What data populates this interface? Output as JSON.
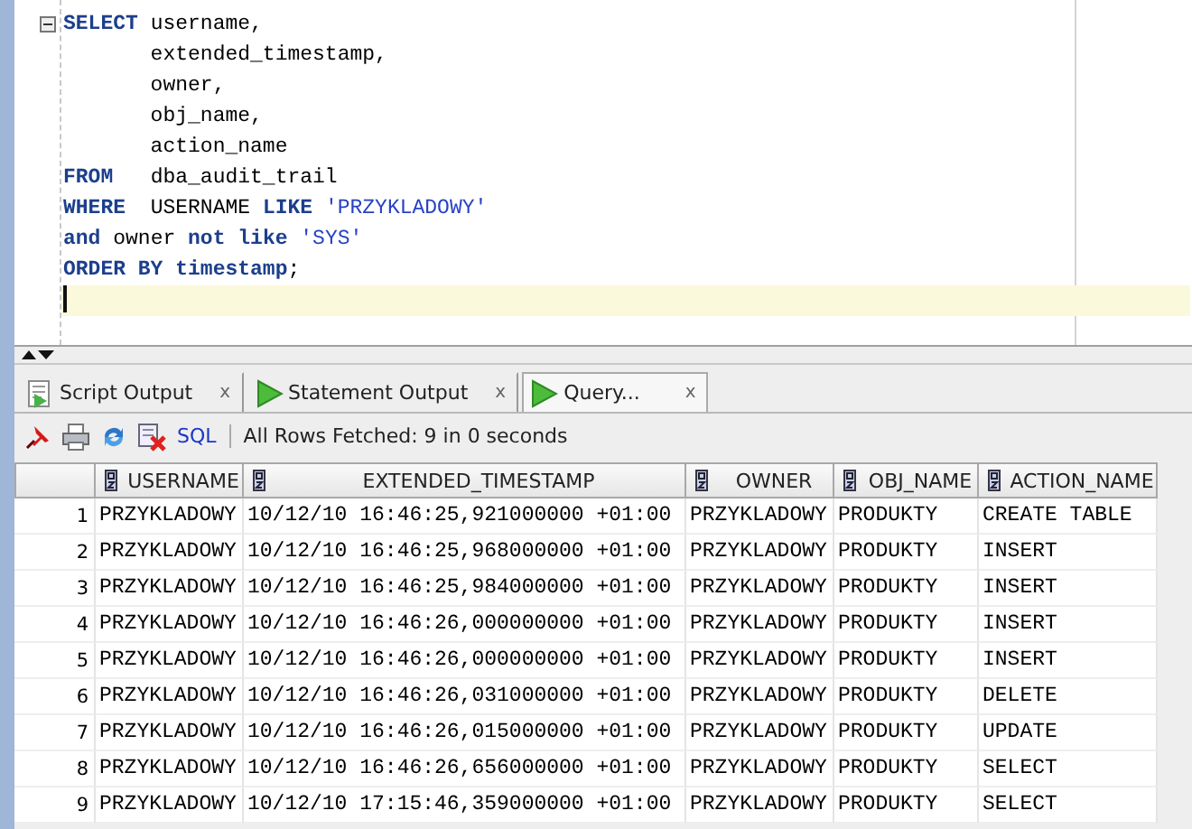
{
  "editor": {
    "lines": [
      {
        "fold_marker": true,
        "current": false,
        "tokens": [
          {
            "kind": "keyword",
            "text": "SELECT"
          },
          {
            "kind": "plain",
            "text": " username,"
          }
        ]
      },
      {
        "fold_marker": false,
        "current": false,
        "tokens": [
          {
            "kind": "plain",
            "text": "       extended_timestamp,"
          }
        ]
      },
      {
        "fold_marker": false,
        "current": false,
        "tokens": [
          {
            "kind": "plain",
            "text": "       owner,"
          }
        ]
      },
      {
        "fold_marker": false,
        "current": false,
        "tokens": [
          {
            "kind": "plain",
            "text": "       obj_name,"
          }
        ]
      },
      {
        "fold_marker": false,
        "current": false,
        "tokens": [
          {
            "kind": "plain",
            "text": "       action_name"
          }
        ]
      },
      {
        "fold_marker": false,
        "current": false,
        "tokens": [
          {
            "kind": "keyword",
            "text": "FROM"
          },
          {
            "kind": "plain",
            "text": "   dba_audit_trail"
          }
        ]
      },
      {
        "fold_marker": false,
        "current": false,
        "tokens": [
          {
            "kind": "keyword",
            "text": "WHERE"
          },
          {
            "kind": "plain",
            "text": "  USERNAME "
          },
          {
            "kind": "keyword",
            "text": "LIKE"
          },
          {
            "kind": "string",
            "text": " 'PRZYKLADOWY'"
          }
        ]
      },
      {
        "fold_marker": false,
        "current": false,
        "tokens": [
          {
            "kind": "keyword",
            "text": "and"
          },
          {
            "kind": "plain",
            "text": " owner "
          },
          {
            "kind": "keyword",
            "text": "not like"
          },
          {
            "kind": "string",
            "text": " 'SYS'"
          }
        ]
      },
      {
        "fold_marker": false,
        "current": false,
        "tokens": [
          {
            "kind": "keyword",
            "text": "ORDER BY timestamp"
          },
          {
            "kind": "plain",
            "text": ";"
          }
        ]
      },
      {
        "fold_marker": false,
        "current": true
      }
    ]
  },
  "tabs": [
    {
      "label": "Script Output",
      "close": "x",
      "kind": "script",
      "selected": false
    },
    {
      "label": "Statement Output",
      "close": "x",
      "kind": "statement",
      "selected": false
    },
    {
      "label": "Query...",
      "close": "x",
      "kind": "query",
      "selected": true
    }
  ],
  "toolbar": {
    "sql_link": "SQL",
    "status": "All Rows Fetched: 9 in 0 seconds"
  },
  "table": {
    "columns": [
      "USERNAME",
      "EXTENDED_TIMESTAMP",
      "OWNER",
      "OBJ_NAME",
      "ACTION_NAME"
    ],
    "rows": [
      {
        "number": "1",
        "cells": [
          "PRZYKLADOWY",
          "10/12/10 16:46:25,921000000 +01:00",
          "PRZYKLADOWY",
          "PRODUKTY",
          "CREATE TABLE"
        ]
      },
      {
        "number": "2",
        "cells": [
          "PRZYKLADOWY",
          "10/12/10 16:46:25,968000000 +01:00",
          "PRZYKLADOWY",
          "PRODUKTY",
          "INSERT"
        ]
      },
      {
        "number": "3",
        "cells": [
          "PRZYKLADOWY",
          "10/12/10 16:46:25,984000000 +01:00",
          "PRZYKLADOWY",
          "PRODUKTY",
          "INSERT"
        ]
      },
      {
        "number": "4",
        "cells": [
          "PRZYKLADOWY",
          "10/12/10 16:46:26,000000000 +01:00",
          "PRZYKLADOWY",
          "PRODUKTY",
          "INSERT"
        ]
      },
      {
        "number": "5",
        "cells": [
          "PRZYKLADOWY",
          "10/12/10 16:46:26,000000000 +01:00",
          "PRZYKLADOWY",
          "PRODUKTY",
          "INSERT"
        ]
      },
      {
        "number": "6",
        "cells": [
          "PRZYKLADOWY",
          "10/12/10 16:46:26,031000000 +01:00",
          "PRZYKLADOWY",
          "PRODUKTY",
          "DELETE"
        ]
      },
      {
        "number": "7",
        "cells": [
          "PRZYKLADOWY",
          "10/12/10 16:46:26,015000000 +01:00",
          "PRZYKLADOWY",
          "PRODUKTY",
          "UPDATE"
        ]
      },
      {
        "number": "8",
        "cells": [
          "PRZYKLADOWY",
          "10/12/10 16:46:26,656000000 +01:00",
          "PRZYKLADOWY",
          "PRODUKTY",
          "SELECT"
        ]
      },
      {
        "number": "9",
        "cells": [
          "PRZYKLADOWY",
          "10/12/10 17:15:46,359000000 +01:00",
          "PRZYKLADOWY",
          "PRODUKTY",
          "SELECT"
        ]
      }
    ]
  }
}
